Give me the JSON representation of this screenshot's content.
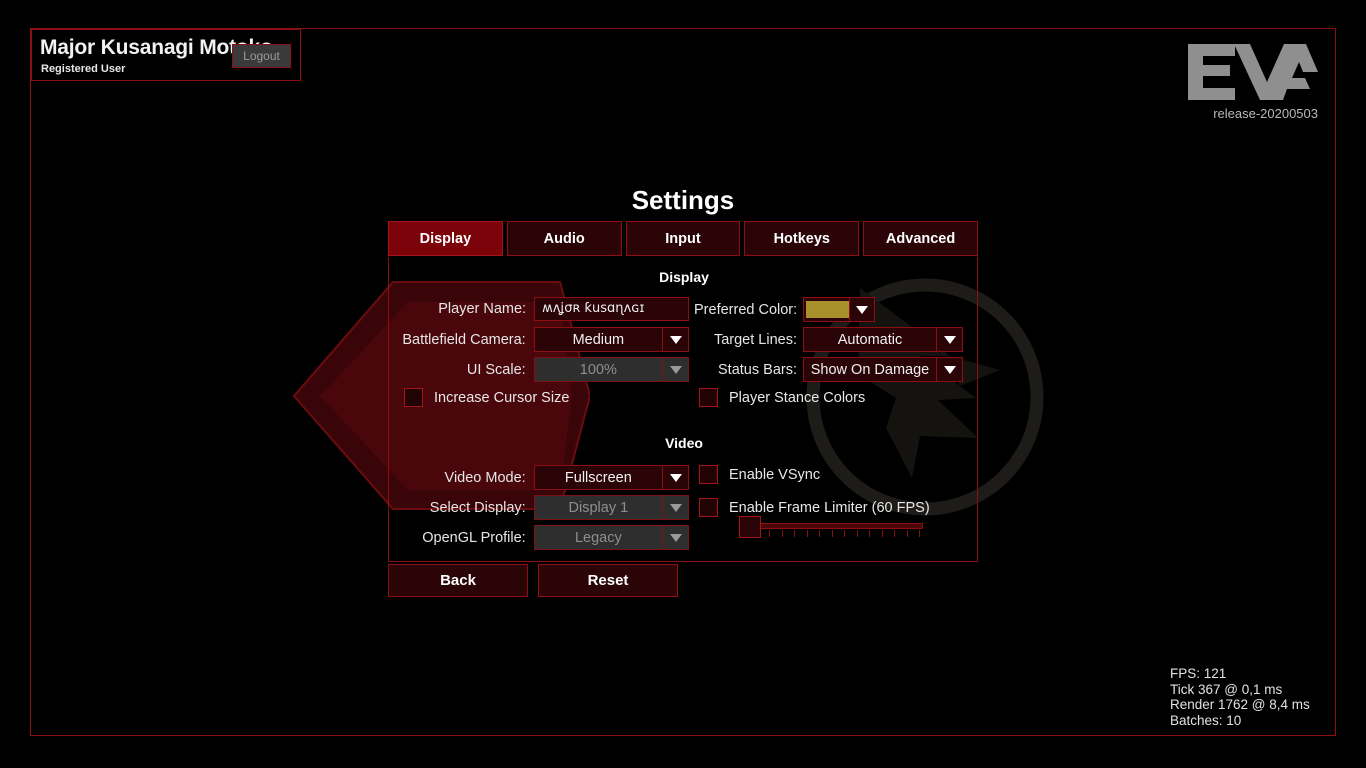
{
  "user": {
    "name": "Major Kusanagi Motoko",
    "role": "Registered User",
    "logout_label": "Logout"
  },
  "brand": {
    "mark": "EVA",
    "release": "release-20200503"
  },
  "page_title": "Settings",
  "tabs": [
    {
      "label": "Display",
      "active": true
    },
    {
      "label": "Audio",
      "active": false
    },
    {
      "label": "Input",
      "active": false
    },
    {
      "label": "Hotkeys",
      "active": false
    },
    {
      "label": "Advanced",
      "active": false
    }
  ],
  "display_section": {
    "heading": "Display",
    "player_name": {
      "label": "Player Name:",
      "value": "ʍʌʝσʀ ƙusɑɳʌɢɪ",
      "placeholder": ""
    },
    "preferred_color": {
      "label": "Preferred Color:",
      "value": "#a8912a",
      "arrow_icon": "chevron-down-icon"
    },
    "battlefield_camera": {
      "label": "Battlefield Camera:",
      "value": "Medium",
      "disabled": false
    },
    "target_lines": {
      "label": "Target Lines:",
      "value": "Automatic",
      "disabled": false
    },
    "ui_scale": {
      "label": "UI Scale:",
      "value": "100%",
      "disabled": true
    },
    "status_bars": {
      "label": "Status Bars:",
      "value": "Show On Damage",
      "disabled": false
    },
    "increase_cursor_size": {
      "label": "Increase Cursor Size",
      "checked": false
    },
    "player_stance_colors": {
      "label": "Player Stance Colors",
      "checked": false
    }
  },
  "video_section": {
    "heading": "Video",
    "video_mode": {
      "label": "Video Mode:",
      "value": "Fullscreen",
      "disabled": false
    },
    "select_display": {
      "label": "Select Display:",
      "value": "Display 1",
      "disabled": true
    },
    "opengl_profile": {
      "label": "OpenGL Profile:",
      "value": "Legacy",
      "disabled": true
    },
    "enable_vsync": {
      "label": "Enable VSync",
      "checked": false
    },
    "enable_frame_limiter": {
      "label": "Enable Frame Limiter (60 FPS)",
      "checked": false
    },
    "frame_limiter_slider": {
      "position_percent": 0
    }
  },
  "footer_buttons": {
    "back": "Back",
    "reset": "Reset"
  },
  "stats": {
    "fps": "FPS: 121",
    "tick": "Tick 367 @ 0,1 ms",
    "render": "Render 1762 @ 8,4 ms",
    "batches": "Batches: 10"
  },
  "colors": {
    "accent_red": "#8d0f14",
    "active_tab": "#7c0309",
    "panel_fill": "#2a0406"
  }
}
